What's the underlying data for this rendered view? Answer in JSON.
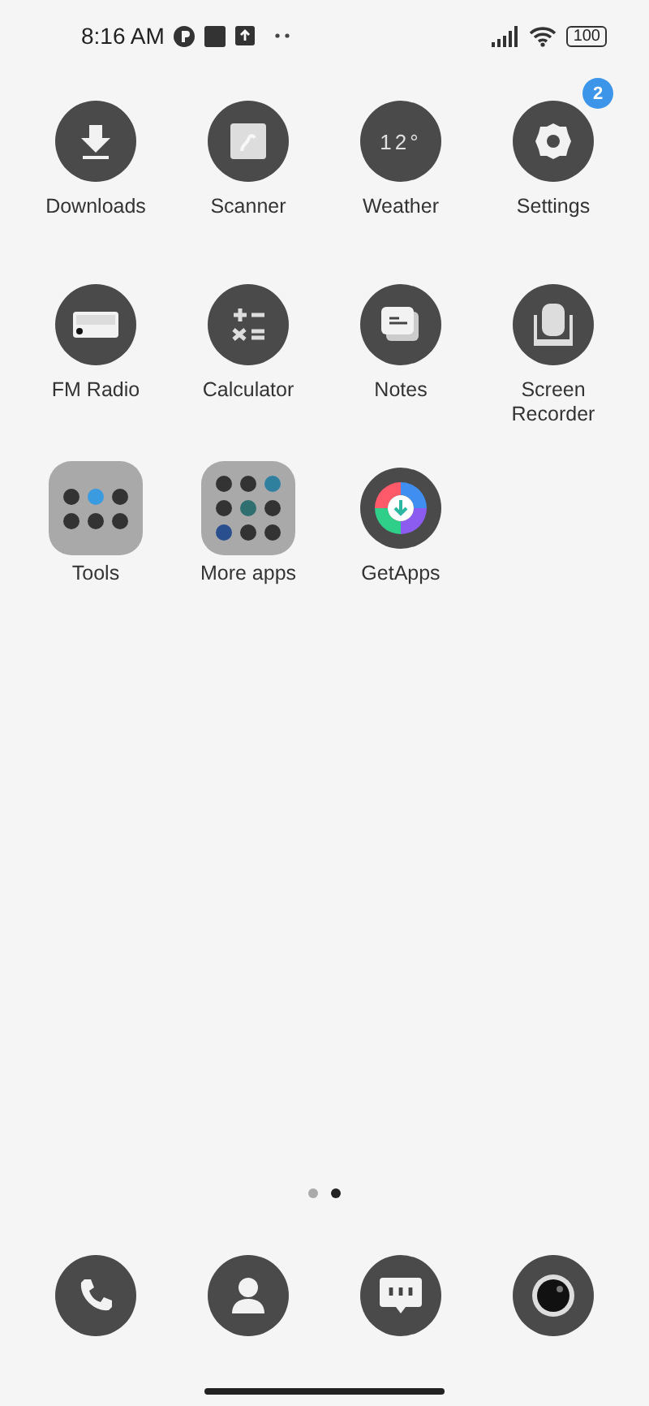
{
  "status_bar": {
    "time": "8:16 AM",
    "battery": "100"
  },
  "apps": [
    {
      "kind": "app",
      "label": "Downloads"
    },
    {
      "kind": "app",
      "label": "Scanner"
    },
    {
      "kind": "app",
      "label": "Weather",
      "icon_text": "12°"
    },
    {
      "kind": "app",
      "label": "Settings",
      "badge": "2"
    },
    {
      "kind": "app",
      "label": "FM Radio"
    },
    {
      "kind": "app",
      "label": "Calculator"
    },
    {
      "kind": "app",
      "label": "Notes"
    },
    {
      "kind": "app",
      "label": "Screen Recorder"
    },
    {
      "kind": "folder",
      "label": "Tools"
    },
    {
      "kind": "folder",
      "label": "More apps"
    },
    {
      "kind": "app",
      "label": "GetApps"
    }
  ],
  "pages": [
    {
      "selected": false
    },
    {
      "selected": true
    }
  ]
}
